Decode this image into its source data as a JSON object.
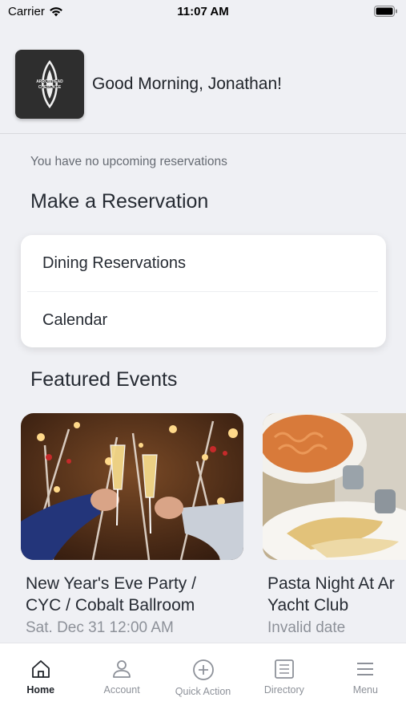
{
  "status_bar": {
    "carrier": "Carrier",
    "time": "11:07 AM"
  },
  "header": {
    "greeting": "Good Morning, Jonathan!",
    "logo_text_top": "ARROWHEAD",
    "logo_text_bottom": "CHEROKEE"
  },
  "reservations": {
    "empty_message": "You have no upcoming reservations",
    "section_title": "Make a Reservation",
    "options": [
      "Dining Reservations",
      "Calendar"
    ]
  },
  "featured": {
    "section_title": "Featured Events",
    "events": [
      {
        "title_line1": "New Year's Eve Party /",
        "title_line2": "CYC / Cobalt Ballroom",
        "date": "Sat. Dec 31 12:00 AM"
      },
      {
        "title_line1": "Pasta Night At Ar",
        "title_line2": "Yacht Club",
        "date": "Invalid date"
      }
    ]
  },
  "tabbar": {
    "tabs": [
      {
        "label": "Home",
        "icon": "home-icon",
        "active": true
      },
      {
        "label": "Account",
        "icon": "user-icon",
        "active": false
      },
      {
        "label": "Quick Action",
        "icon": "plus-circle-icon",
        "active": false
      },
      {
        "label": "Directory",
        "icon": "list-icon",
        "active": false
      },
      {
        "label": "Menu",
        "icon": "hamburger-icon",
        "active": false
      }
    ]
  },
  "colors": {
    "background": "#eff0f4",
    "text": "#262b33",
    "muted": "#8d9199",
    "card": "#ffffff"
  }
}
